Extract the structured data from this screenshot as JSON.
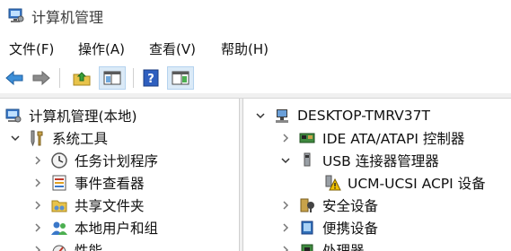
{
  "window": {
    "title": "计算机管理"
  },
  "menu": [
    {
      "label": "文件(F)"
    },
    {
      "label": "操作(A)"
    },
    {
      "label": "查看(V)"
    },
    {
      "label": "帮助(H)"
    }
  ],
  "toolbar": {
    "buttons": [
      {
        "icon": "back-arrow-icon"
      },
      {
        "icon": "forward-arrow-icon"
      },
      {
        "icon": "up-folder-icon"
      },
      {
        "icon": "show-hide-console-tree-icon"
      },
      {
        "icon": "help-icon"
      },
      {
        "icon": "show-hide-action-pane-icon"
      }
    ]
  },
  "left_tree": [
    {
      "label": "计算机管理(本地)",
      "icon": "computer-management-icon",
      "level": 0,
      "expander": "none"
    },
    {
      "label": "系统工具",
      "icon": "system-tools-icon",
      "level": 1,
      "expander": "expanded"
    },
    {
      "label": "任务计划程序",
      "icon": "task-scheduler-icon",
      "level": 2,
      "expander": "collapsed"
    },
    {
      "label": "事件查看器",
      "icon": "event-viewer-icon",
      "level": 2,
      "expander": "collapsed"
    },
    {
      "label": "共享文件夹",
      "icon": "shared-folders-icon",
      "level": 2,
      "expander": "collapsed"
    },
    {
      "label": "本地用户和组",
      "icon": "local-users-groups-icon",
      "level": 2,
      "expander": "collapsed"
    },
    {
      "label": "性能",
      "icon": "performance-icon",
      "level": 2,
      "expander": "collapsed"
    }
  ],
  "right_tree": [
    {
      "label": "DESKTOP-TMRV37T",
      "icon": "computer-icon",
      "level": 0,
      "expander": "expanded"
    },
    {
      "label": "IDE ATA/ATAPI 控制器",
      "icon": "ide-controller-icon",
      "level": 1,
      "expander": "collapsed"
    },
    {
      "label": "USB 连接器管理器",
      "icon": "usb-connector-icon",
      "level": 1,
      "expander": "expanded"
    },
    {
      "label": "UCM-UCSI ACPI 设备",
      "icon": "warning-device-icon",
      "level": 2,
      "expander": "none"
    },
    {
      "label": "安全设备",
      "icon": "security-device-icon",
      "level": 1,
      "expander": "collapsed"
    },
    {
      "label": "便携设备",
      "icon": "portable-device-icon",
      "level": 1,
      "expander": "collapsed"
    },
    {
      "label": "处理器",
      "icon": "processor-icon",
      "level": 1,
      "expander": "collapsed"
    }
  ]
}
